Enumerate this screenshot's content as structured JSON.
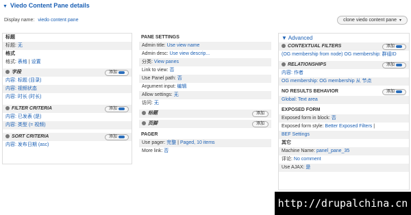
{
  "header": {
    "title": "Viedo Content Pane details"
  },
  "display": {
    "label": "Display name:",
    "value": "viedo content pane",
    "clone_label": "clone viedo content pane"
  },
  "col1": {
    "title_section": "标题",
    "title_row": {
      "label": "标题:",
      "value": "无"
    },
    "format_section": "格式",
    "format_row": {
      "label": "格式:",
      "value1": "表格",
      "sep": "|",
      "value2": "设置"
    },
    "fields": {
      "label": "字段",
      "add": "添加",
      "items": [
        "内容: 标题 (目录)",
        "内容: 视频状态",
        "内容: 时长 (时长)"
      ]
    },
    "filters": {
      "label": "FILTER CRITERIA",
      "add": "添加",
      "items": [
        "内容: 已发表 (是)",
        "内容: 类型 (= 视频)"
      ]
    },
    "sort": {
      "label": "SORT CRITERIA",
      "add": "添加",
      "items": [
        "内容: 发布日期 (asc)"
      ]
    }
  },
  "col2": {
    "pane_settings": "PANE SETTINGS",
    "rows": [
      {
        "label": "Admin title:",
        "value": "Use view name"
      },
      {
        "label": "Admin desc:",
        "value": "Use view descrip..."
      },
      {
        "label": "分类:",
        "value": "View panes"
      },
      {
        "label": "Link to view:",
        "value": "否"
      },
      {
        "label": "Use Panel path:",
        "value": "否"
      },
      {
        "label": "Argument input:",
        "value": "编辑"
      },
      {
        "label": "Allow settings:",
        "value": "无"
      },
      {
        "label": "访问:",
        "value": "无"
      }
    ],
    "header_section": {
      "label": "标题",
      "add": "添加"
    },
    "footer_section": {
      "label": "页脚",
      "add": "添加"
    },
    "pager": "PAGER",
    "use_pager": {
      "label": "Use pager:",
      "value1": "完整",
      "sep": "|",
      "value2": "Paged, 10 items"
    },
    "more_link": {
      "label": "More link:",
      "value": "否"
    }
  },
  "col3": {
    "advanced": "Advanced",
    "contextual": {
      "label": "CONTEXTUAL FILTERS",
      "add": "添加",
      "items": [
        "(OG membership from node) OG membership: 群组ID"
      ]
    },
    "relationships": {
      "label": "RELATIONSHIPS",
      "add": "添加",
      "items": [
        "内容: 作者",
        "OG membership: OG membership 从 节点"
      ]
    },
    "no_results": {
      "label": "NO RESULTS BEHAVIOR",
      "add": "添加",
      "items": [
        "Global: Text area"
      ]
    },
    "exposed": {
      "label": "EXPOSED FORM",
      "in_block": {
        "label": "Exposed form in block:",
        "value": "否"
      },
      "style": {
        "label": "Exposed form style:",
        "value1": "Better Exposed Filters",
        "sep": "|",
        "value2": "BEF Settings"
      }
    },
    "other": {
      "label": "其它",
      "machine": {
        "label": "Machine Name:",
        "value": "panel_pane_35"
      },
      "comment": {
        "label": "评论:",
        "value": "No comment"
      },
      "ajax": {
        "label": "Use AJAX:",
        "value": "是"
      }
    }
  },
  "watermark": "http://drupalchina.cn"
}
